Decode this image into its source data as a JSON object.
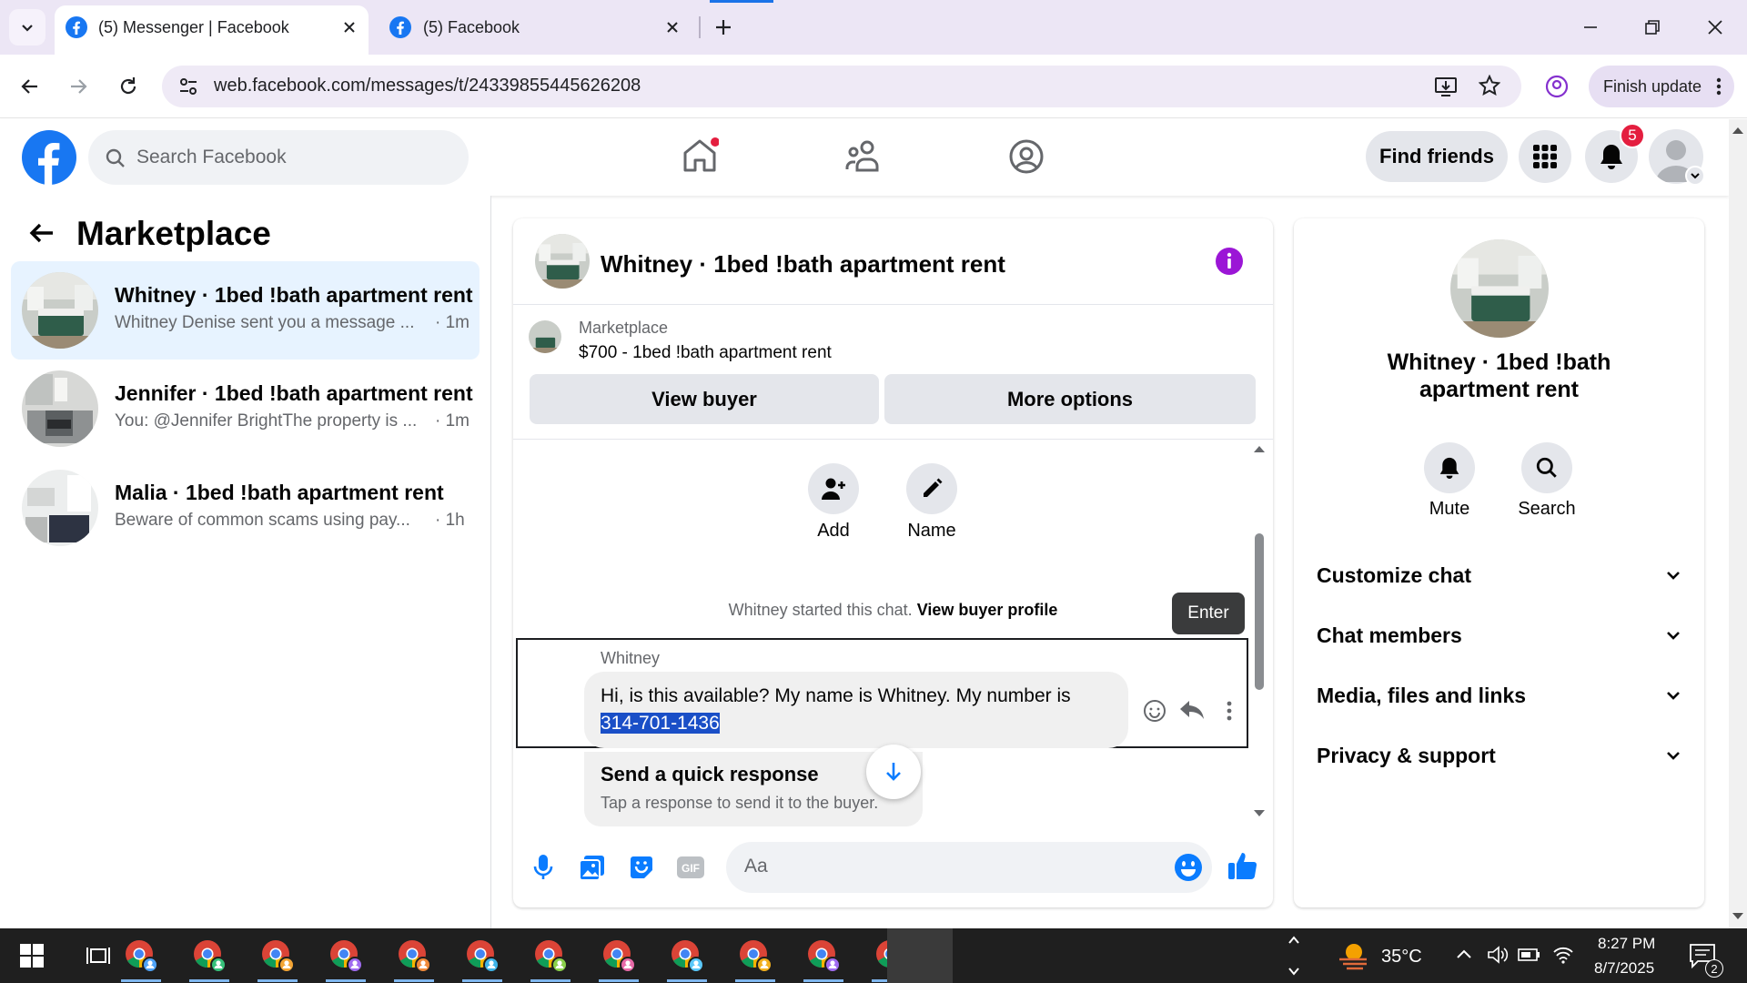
{
  "browser": {
    "tabs": [
      {
        "title": "(5) Messenger | Facebook",
        "active": true
      },
      {
        "title": "(5) Facebook",
        "active": false
      }
    ],
    "url": "web.facebook.com/messages/t/24339855445626208",
    "finish_update": "Finish update"
  },
  "fb_header": {
    "search_placeholder": "Search Facebook",
    "find_friends": "Find friends",
    "notification_count": "5",
    "brand_color": "#1877F2"
  },
  "left_panel": {
    "title": "Marketplace",
    "conversations": [
      {
        "name": "Whitney · 1bed !bath apartment rent",
        "preview": "Whitney Denise sent you a message ...",
        "time": "· 1m",
        "active": true
      },
      {
        "name": "Jennifer · 1bed !bath apartment rent",
        "preview": "You: @Jennifer BrightThe property is ...",
        "time": "· 1m",
        "active": false
      },
      {
        "name": "Malia · 1bed !bath apartment rent",
        "preview": "Beware of common scams using pay...",
        "time": "· 1h",
        "active": false
      }
    ]
  },
  "chat": {
    "title": "Whitney · 1bed !bath apartment rent",
    "marketplace_label": "Marketplace",
    "listing": "$700 - 1bed !bath apartment rent",
    "view_buyer": "View buyer",
    "more_options": "More options",
    "add_label": "Add",
    "name_label": "Name",
    "started_text": "Whitney started this chat.",
    "view_buyer_profile": "View buyer profile",
    "tooltip": "Enter",
    "sender": "Whitney",
    "message_text": "Hi, is this available? My name is Whitney. My number is",
    "message_number": "314-701-1436",
    "quick_title": "Send a quick response",
    "quick_sub": "Tap a response to send it to the buyer.",
    "composer_placeholder": "Aa"
  },
  "right_panel": {
    "title": "Whitney · 1bed !bath apartment rent",
    "mute": "Mute",
    "search": "Search",
    "sections": [
      "Customize chat",
      "Chat members",
      "Media, files and links",
      "Privacy & support"
    ]
  },
  "taskbar": {
    "temperature": "35°C",
    "time": "8:27 PM",
    "date": "8/7/2025",
    "notification_badge": "2"
  }
}
